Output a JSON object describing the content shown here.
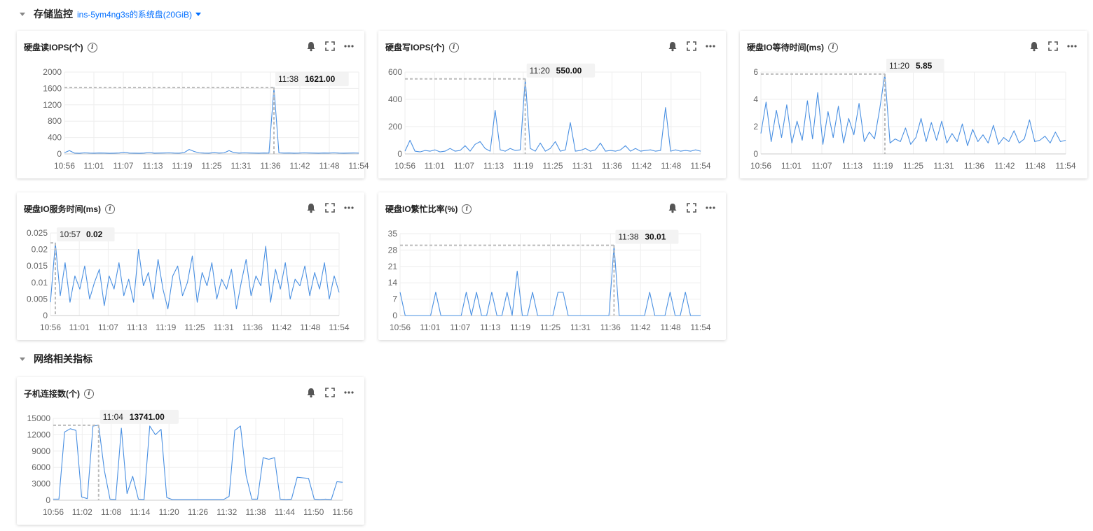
{
  "sections": {
    "storage": {
      "title": "存储监控",
      "subtitle": "ins-5ym4ng3s的系统盘(20GiB)"
    },
    "network": {
      "title": "网络相关指标"
    }
  },
  "colors": {
    "line": "#4a90e2",
    "grid": "#eeeeee",
    "accent": "#006eff",
    "guide": "#bbbbbb"
  },
  "icons": [
    "info-icon",
    "bell-icon",
    "fullscreen-icon",
    "more-icon",
    "caret-down-icon"
  ],
  "charts": [
    {
      "id": "read_iops",
      "title": "硬盘读IOPS(个)",
      "chart_data": {
        "type": "line",
        "y_ticks": [
          "0",
          "400",
          "800",
          "1200",
          "1600",
          "2000"
        ],
        "ylim": [
          0,
          2000
        ],
        "x_ticks": [
          "10:56",
          "11:01",
          "11:07",
          "11:13",
          "11:19",
          "11:25",
          "11:31",
          "11:36",
          "11:42",
          "11:48",
          "11:54"
        ],
        "tooltip": {
          "time": "11:38",
          "value": "1621.00",
          "value_num": 1621,
          "index": 42
        },
        "values": [
          30,
          80,
          20,
          15,
          25,
          20,
          18,
          22,
          20,
          15,
          18,
          22,
          40,
          20,
          18,
          15,
          20,
          35,
          18,
          20,
          22,
          25,
          20,
          18,
          30,
          110,
          60,
          25,
          20,
          18,
          30,
          20,
          25,
          80,
          30,
          20,
          25,
          22,
          20,
          18,
          22,
          20,
          1621,
          25,
          20,
          22,
          18,
          20,
          25,
          22,
          20,
          18,
          22,
          20,
          25,
          20,
          18,
          20,
          22,
          20
        ]
      }
    },
    {
      "id": "write_iops",
      "title": "硬盘写IOPS(个)",
      "chart_data": {
        "type": "line",
        "y_ticks": [
          "0",
          "200",
          "400",
          "600"
        ],
        "ylim": [
          0,
          600
        ],
        "x_ticks": [
          "10:56",
          "11:01",
          "11:07",
          "11:13",
          "11:19",
          "11:25",
          "11:31",
          "11:36",
          "11:42",
          "11:48",
          "11:54"
        ],
        "tooltip": {
          "time": "11:20",
          "value": "550.00",
          "value_num": 550,
          "index": 24
        },
        "values": [
          20,
          100,
          20,
          15,
          25,
          20,
          30,
          15,
          20,
          40,
          20,
          25,
          60,
          20,
          70,
          90,
          40,
          20,
          320,
          30,
          20,
          40,
          25,
          30,
          550,
          40,
          20,
          80,
          20,
          40,
          90,
          20,
          30,
          230,
          20,
          25,
          40,
          20,
          30,
          80,
          20,
          25,
          20,
          30,
          60,
          20,
          40,
          20,
          25,
          30,
          20,
          25,
          340,
          20,
          30,
          20,
          25,
          20,
          30,
          20
        ]
      }
    },
    {
      "id": "io_wait",
      "title": "硬盘IO等待时间(ms)",
      "chart_data": {
        "type": "line",
        "y_ticks": [
          "0",
          "2",
          "4",
          "6"
        ],
        "ylim": [
          0,
          6
        ],
        "x_ticks": [
          "10:56",
          "11:01",
          "11:07",
          "11:13",
          "11:19",
          "11:25",
          "11:31",
          "11:36",
          "11:42",
          "11:48",
          "11:54"
        ],
        "tooltip": {
          "time": "11:20",
          "value": "5.85",
          "value_num": 5.85,
          "index": 24
        },
        "values": [
          1.5,
          3.8,
          0.9,
          3.2,
          1.2,
          3.6,
          0.8,
          2.4,
          1.0,
          3.9,
          1.1,
          4.5,
          0.7,
          3.1,
          1.2,
          3.5,
          0.8,
          2.6,
          1.4,
          3.7,
          0.9,
          1.6,
          1.1,
          3.3,
          5.85,
          0.8,
          1.1,
          0.9,
          1.9,
          0.7,
          1.2,
          2.6,
          0.9,
          2.3,
          1.0,
          2.4,
          0.8,
          1.5,
          0.9,
          2.2,
          0.6,
          1.8,
          0.9,
          1.4,
          0.8,
          2.1,
          0.7,
          1.2,
          0.9,
          1.7,
          0.8,
          1.1,
          2.5,
          0.9,
          1.0,
          1.3,
          0.8,
          1.6,
          0.9,
          1.0
        ]
      }
    },
    {
      "id": "io_service",
      "title": "硬盘IO服务时间(ms)",
      "chart_data": {
        "type": "line",
        "y_ticks": [
          "0",
          "0.005",
          "0.01",
          "0.015",
          "0.02",
          "0.025"
        ],
        "ylim": [
          0,
          0.025
        ],
        "x_ticks": [
          "10:56",
          "11:01",
          "11:07",
          "11:13",
          "11:19",
          "11:25",
          "11:31",
          "11:36",
          "11:42",
          "11:48",
          "11:54"
        ],
        "tooltip": {
          "time": "10:57",
          "value": "0.02",
          "value_num": 0.022,
          "index": 1
        },
        "values": [
          0.004,
          0.022,
          0.006,
          0.016,
          0.004,
          0.012,
          0.008,
          0.015,
          0.005,
          0.01,
          0.014,
          0.003,
          0.012,
          0.008,
          0.016,
          0.006,
          0.011,
          0.004,
          0.02,
          0.009,
          0.013,
          0.005,
          0.017,
          0.008,
          0.002,
          0.012,
          0.015,
          0.006,
          0.01,
          0.018,
          0.004,
          0.013,
          0.009,
          0.016,
          0.005,
          0.011,
          0.008,
          0.014,
          0.002,
          0.01,
          0.017,
          0.006,
          0.012,
          0.009,
          0.021,
          0.004,
          0.014,
          0.008,
          0.016,
          0.005,
          0.011,
          0.009,
          0.015,
          0.006,
          0.013,
          0.008,
          0.016,
          0.005,
          0.012,
          0.007
        ]
      }
    },
    {
      "id": "io_busy",
      "title": "硬盘IO繁忙比率(%)",
      "chart_data": {
        "type": "line",
        "y_ticks": [
          "0",
          "7",
          "14",
          "21",
          "28",
          "35"
        ],
        "ylim": [
          0,
          35
        ],
        "x_ticks": [
          "10:56",
          "11:01",
          "11:07",
          "11:13",
          "11:19",
          "11:25",
          "11:31",
          "11:36",
          "11:42",
          "11:48",
          "11:54"
        ],
        "tooltip": {
          "time": "11:38",
          "value": "30.01",
          "value_num": 30.01,
          "index": 42
        },
        "values": [
          10,
          0,
          0,
          0,
          0,
          0,
          0,
          10,
          0,
          0,
          0,
          0,
          0,
          10,
          0,
          10,
          0,
          0,
          10,
          0,
          0,
          10,
          0,
          19,
          0,
          0,
          10,
          0,
          0,
          0,
          0,
          10,
          10,
          0,
          0,
          0,
          0,
          0,
          0,
          0,
          0,
          0,
          30.01,
          0,
          0,
          0,
          0,
          0,
          0,
          10,
          0,
          0,
          0,
          10,
          0,
          0,
          10,
          0,
          0,
          0
        ]
      }
    },
    {
      "id": "connections",
      "title": "子机连接数(个)",
      "chart_data": {
        "type": "line",
        "y_ticks": [
          "0",
          "3000",
          "6000",
          "9000",
          "12000",
          "15000"
        ],
        "ylim": [
          0,
          15000
        ],
        "x_ticks": [
          "10:56",
          "11:02",
          "11:08",
          "11:14",
          "11:20",
          "11:26",
          "11:32",
          "11:38",
          "11:44",
          "11:50",
          "11:56"
        ],
        "tooltip": {
          "time": "11:04",
          "value": "13741.00",
          "value_num": 13741,
          "index": 8
        },
        "values": [
          200,
          200,
          12500,
          13100,
          12800,
          600,
          300,
          13600,
          13741,
          5500,
          200,
          100,
          13200,
          1200,
          4400,
          200,
          100,
          13600,
          12000,
          13000,
          500,
          100,
          100,
          100,
          100,
          100,
          100,
          100,
          100,
          100,
          100,
          700,
          12800,
          13600,
          4500,
          200,
          200,
          7800,
          7500,
          7800,
          200,
          100,
          200,
          4200,
          4100,
          4000,
          200,
          100,
          200,
          100,
          3400,
          3300
        ]
      }
    }
  ]
}
